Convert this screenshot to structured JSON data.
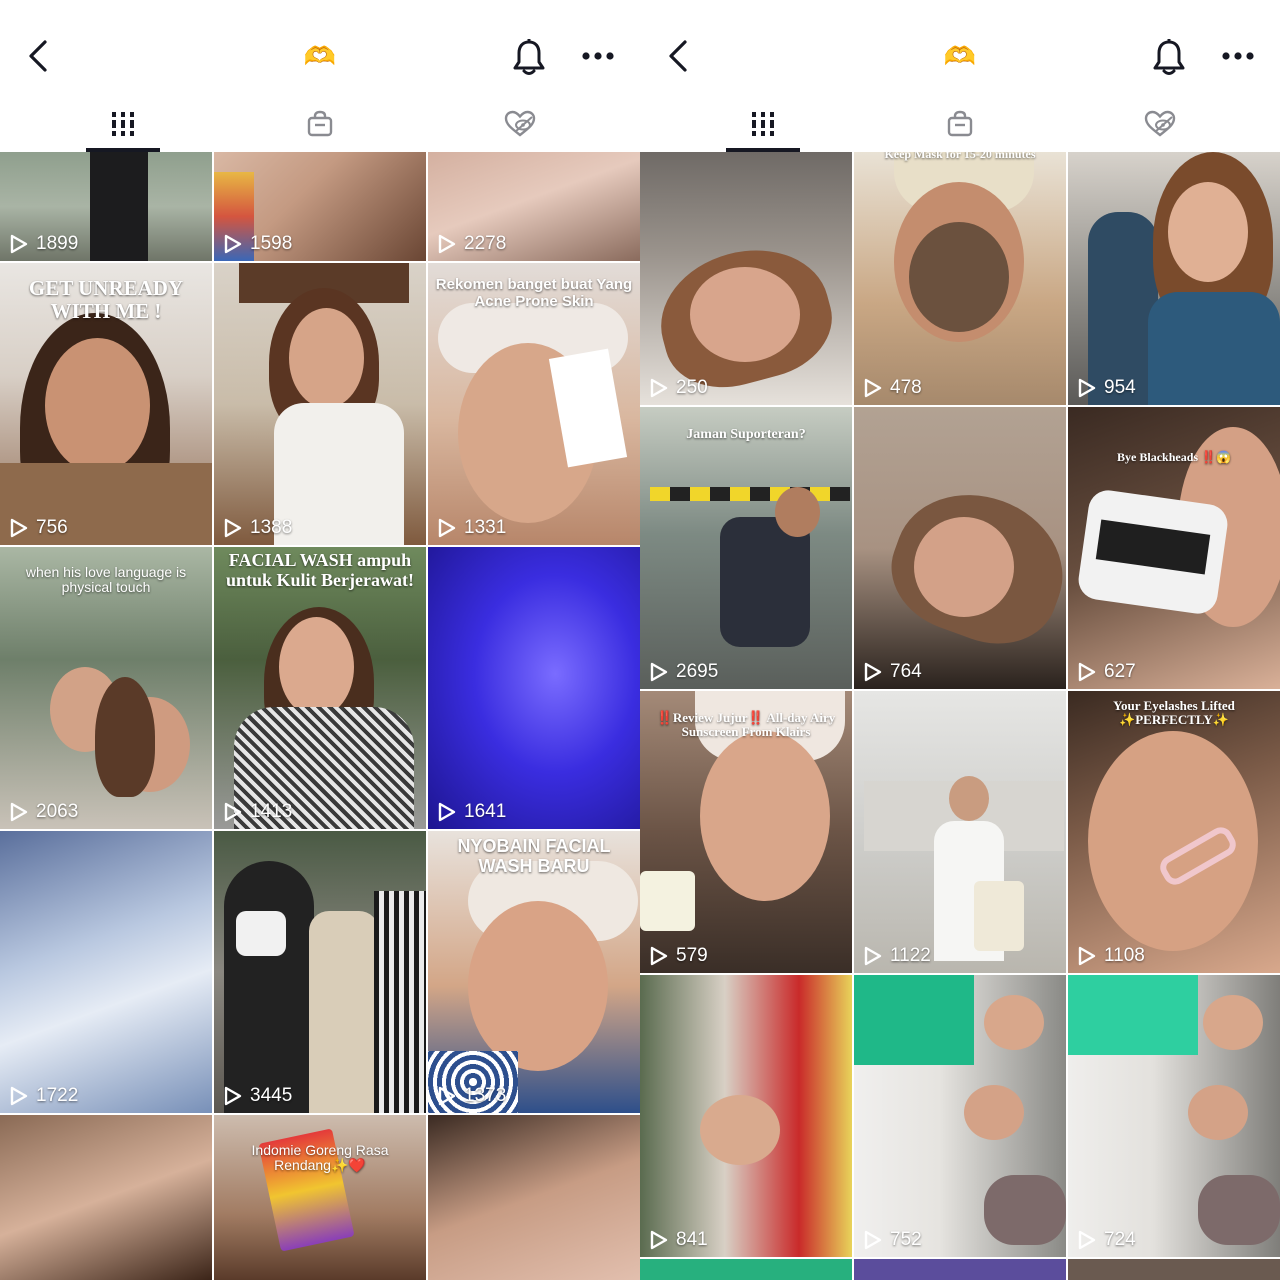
{
  "left": {
    "header": {
      "back_icon": "chevron-left-icon",
      "center_icon": "heart-hands-emoji",
      "center_glyph": "🫶",
      "bell_icon": "bell-icon",
      "more_icon": "more-horizontal-icon"
    },
    "tabs": [
      {
        "icon": "grid-icon",
        "active": true
      },
      {
        "icon": "shopping-bag-icon",
        "active": false
      },
      {
        "icon": "liked-hidden-icon",
        "active": false
      }
    ],
    "videos": [
      {
        "views": "1899",
        "caption": ""
      },
      {
        "views": "1598",
        "caption": ""
      },
      {
        "views": "2278",
        "caption": ""
      },
      {
        "views": "756",
        "caption": "GET UNREADY WITH ME !"
      },
      {
        "views": "1388",
        "caption": ""
      },
      {
        "views": "1331",
        "caption": "Rekomen banget buat Yang Acne Prone Skin"
      },
      {
        "views": "2063",
        "caption": "when his love language is physical touch"
      },
      {
        "views": "1413",
        "caption": "FACIAL WASH ampuh untuk Kulit Berjerawat!"
      },
      {
        "views": "1641",
        "caption": ""
      },
      {
        "views": "1722",
        "caption": ""
      },
      {
        "views": "3445",
        "caption": ""
      },
      {
        "views": "1373",
        "caption": "NYOBAIN FACIAL WASH BARU"
      },
      {
        "views": "",
        "caption": ""
      },
      {
        "views": "",
        "caption": "Indomie Goreng Rasa Rendang✨❤️"
      },
      {
        "views": "",
        "caption": ""
      }
    ]
  },
  "right": {
    "header": {
      "back_icon": "chevron-left-icon",
      "center_icon": "heart-hands-emoji",
      "center_glyph": "🫶",
      "bell_icon": "bell-icon",
      "more_icon": "more-horizontal-icon"
    },
    "tabs": [
      {
        "icon": "grid-icon",
        "active": true
      },
      {
        "icon": "shopping-bag-icon",
        "active": false
      },
      {
        "icon": "liked-hidden-icon",
        "active": false
      }
    ],
    "videos": [
      {
        "views": "250",
        "caption": ""
      },
      {
        "views": "478",
        "caption": "Keep Mask for 15-20 minutes"
      },
      {
        "views": "954",
        "caption": ""
      },
      {
        "views": "2695",
        "caption": "Jaman Suporteran?"
      },
      {
        "views": "764",
        "caption": ""
      },
      {
        "views": "627",
        "caption": "Bye Blackheads ‼️😱"
      },
      {
        "views": "579",
        "caption": "‼️Review Jujur‼️ All-day Airy Sunscreen From Klairs"
      },
      {
        "views": "1122",
        "caption": ""
      },
      {
        "views": "1108",
        "caption": "Your Eyelashes Lifted ✨PERFECTLY✨"
      },
      {
        "views": "841",
        "caption": ""
      },
      {
        "views": "752",
        "caption": ""
      },
      {
        "views": "724",
        "caption": ""
      }
    ]
  },
  "colors": {
    "text": "#161823",
    "white": "#ffffff",
    "accent_heart": "#f0a56a"
  }
}
